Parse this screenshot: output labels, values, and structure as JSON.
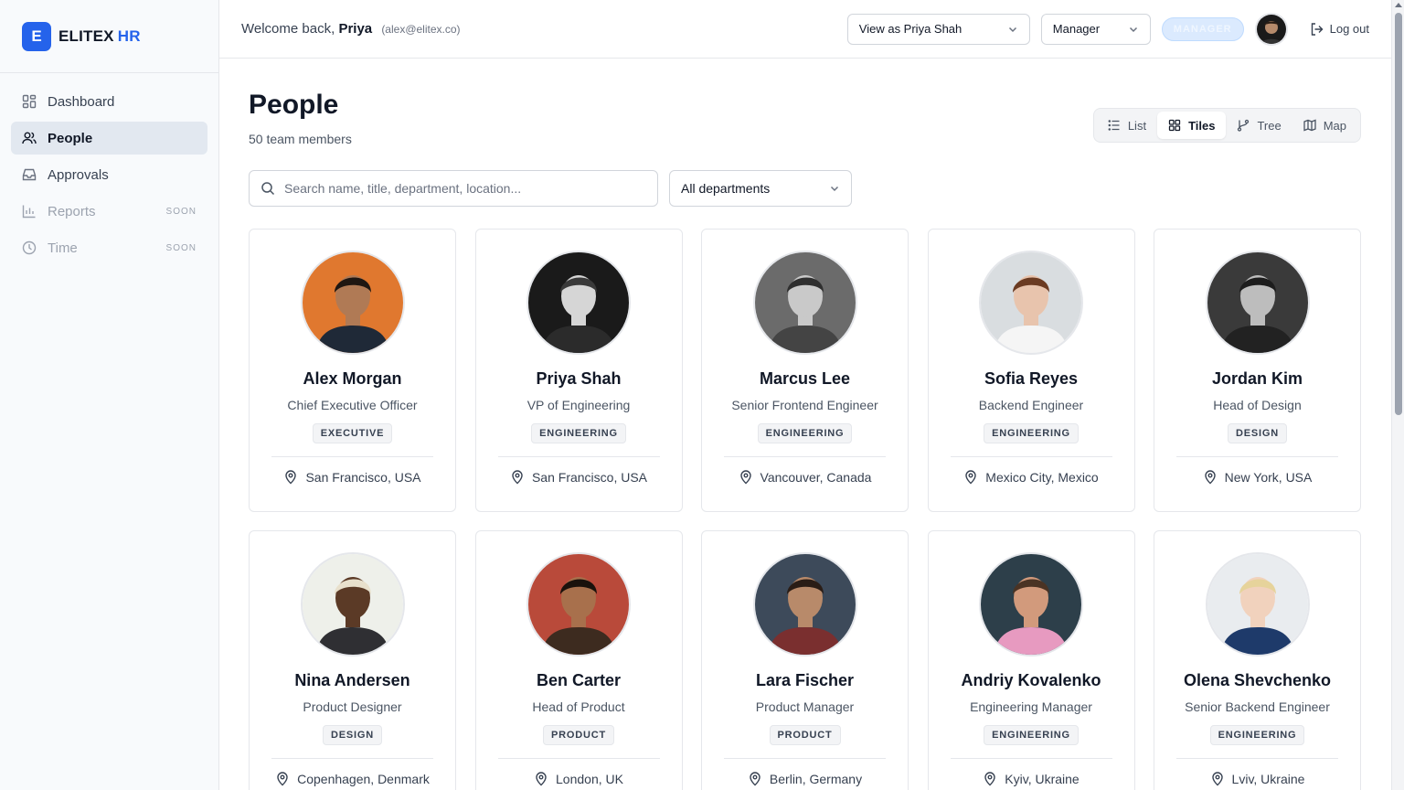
{
  "brand": {
    "logo_letter": "E",
    "name": "ELITEX",
    "accent": "HR",
    "color": "#2563eb"
  },
  "sidebar": {
    "items": [
      {
        "label": "Dashboard",
        "icon": "dashboard-icon",
        "active": false
      },
      {
        "label": "People",
        "icon": "users-icon",
        "active": true
      },
      {
        "label": "Approvals",
        "icon": "inbox-icon",
        "active": false
      },
      {
        "label": "Reports",
        "icon": "bar-chart-icon",
        "badge": "SOON"
      },
      {
        "label": "Time",
        "icon": "clock-icon",
        "badge": "SOON"
      }
    ]
  },
  "header": {
    "welcome": "Welcome back,",
    "user_name": "Priya",
    "user_email": "(alex@elitex.co)",
    "view_as": "View as Priya Shah",
    "role_select": "Manager",
    "role_badge": "MANAGER",
    "logout": "Log out"
  },
  "page": {
    "title": "People",
    "subtitle": "50 team members",
    "views": [
      "List",
      "Tiles",
      "Tree",
      "Map"
    ],
    "active_view": "Tiles",
    "search_placeholder": "Search name, title, department, location...",
    "dept_filter": "All departments"
  },
  "people": [
    {
      "name": "Alex Morgan",
      "title": "Chief Executive Officer",
      "dept": "EXECUTIVE",
      "location": "San Francisco, USA",
      "skin": "#b07a55",
      "hair": "#1f1712",
      "bg": "#e0782f",
      "shirt": "#1f2937"
    },
    {
      "name": "Priya Shah",
      "title": "VP of Engineering",
      "dept": "ENGINEERING",
      "location": "San Francisco, USA",
      "skin": "#d6d6d6",
      "hair": "#3a3a3a",
      "bg": "#1a1a1a",
      "shirt": "#2b2b2b"
    },
    {
      "name": "Marcus Lee",
      "title": "Senior Frontend Engineer",
      "dept": "ENGINEERING",
      "location": "Vancouver, Canada",
      "skin": "#c9c9c9",
      "hair": "#2f2f2f",
      "bg": "#6b6b6b",
      "shirt": "#444444"
    },
    {
      "name": "Sofia Reyes",
      "title": "Backend Engineer",
      "dept": "ENGINEERING",
      "location": "Mexico City, Mexico",
      "skin": "#e8c4ad",
      "hair": "#6b3b22",
      "bg": "#d9dde0",
      "shirt": "#f5f5f5"
    },
    {
      "name": "Jordan Kim",
      "title": "Head of Design",
      "dept": "DESIGN",
      "location": "New York, USA",
      "skin": "#bdbdbd",
      "hair": "#1d1d1d",
      "bg": "#3a3a3a",
      "shirt": "#222222"
    },
    {
      "name": "Nina Andersen",
      "title": "Product Designer",
      "dept": "DESIGN",
      "location": "Copenhagen, Denmark",
      "skin": "#5b3a26",
      "hair": "#e8e0cc",
      "bg": "#eef0ea",
      "shirt": "#2f2f33"
    },
    {
      "name": "Ben Carter",
      "title": "Head of Product",
      "dept": "PRODUCT",
      "location": "London, UK",
      "skin": "#a8704c",
      "hair": "#1a120c",
      "bg": "#b94a3a",
      "shirt": "#3d2b1f"
    },
    {
      "name": "Lara Fischer",
      "title": "Product Manager",
      "dept": "PRODUCT",
      "location": "Berlin, Germany",
      "skin": "#b88a6a",
      "hair": "#2a1d16",
      "bg": "#3d4a5a",
      "shirt": "#7a2f2f"
    },
    {
      "name": "Andriy Kovalenko",
      "title": "Engineering Manager",
      "dept": "ENGINEERING",
      "location": "Kyiv, Ukraine",
      "skin": "#d29a7c",
      "hair": "#4a3324",
      "bg": "#2d3f4a",
      "shirt": "#e79ac0"
    },
    {
      "name": "Olena Shevchenko",
      "title": "Senior Backend Engineer",
      "dept": "ENGINEERING",
      "location": "Lviv, Ukraine",
      "skin": "#f1d2bd",
      "hair": "#e6d39b",
      "bg": "#e9ecef",
      "shirt": "#1e3a6a"
    }
  ]
}
